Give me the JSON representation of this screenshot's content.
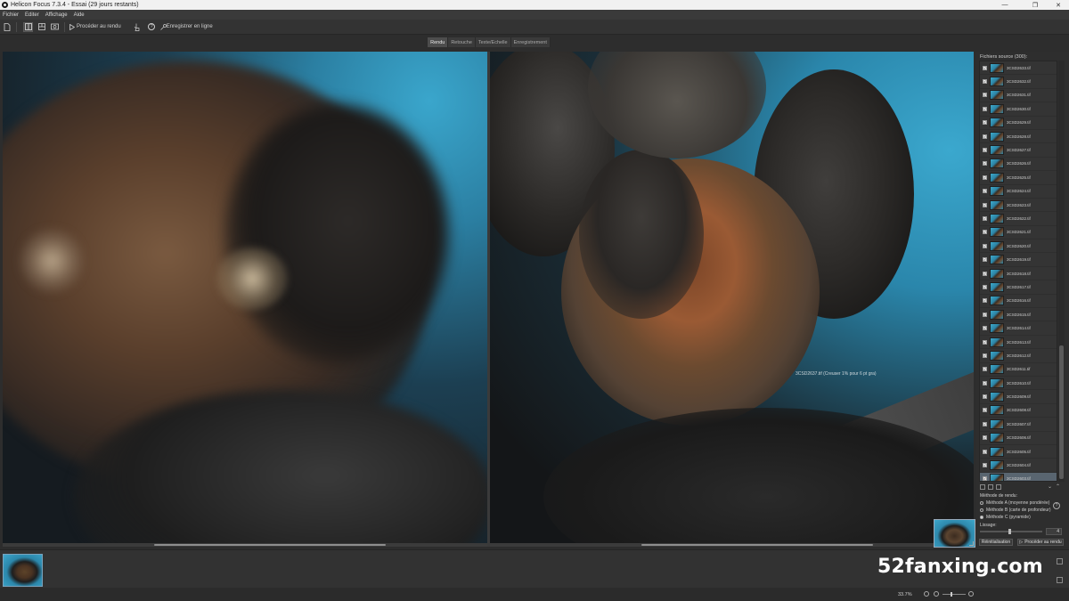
{
  "window": {
    "title": "Helicon Focus 7.3.4 - Essai (29 jours restants)",
    "minimize_glyph": "—",
    "maximize_glyph": "❐",
    "close_glyph": "✕"
  },
  "menu": [
    "Fichier",
    "Editer",
    "Affichage",
    "Aide"
  ],
  "toolbar": {
    "render_label": "Procéder au rendu",
    "save_online_label": "Enregistrer en ligne",
    "help_glyph": "?"
  },
  "tabs": [
    "Rendu",
    "Retouche",
    "Texte/Echelle",
    "Enregistrement"
  ],
  "active_tab": "Rendu",
  "viewer": {
    "tooltip": "3CSD2637.tif (Creuser 1% pour 6 pt gra)"
  },
  "source_panel": {
    "title": "Fichiers source (300):",
    "files": [
      "3CSD2633.tif",
      "3CSD2632.tif",
      "3CSD2631.tif",
      "3CSD2630.tif",
      "3CSD2629.tif",
      "3CSD2628.tif",
      "3CSD2627.tif",
      "3CSD2626.tif",
      "3CSD2625.tif",
      "3CSD2624.tif",
      "3CSD2623.tif",
      "3CSD2622.tif",
      "3CSD2621.tif",
      "3CSD2620.tif",
      "3CSD2619.tif",
      "3CSD2618.tif",
      "3CSD2617.tif",
      "3CSD2616.tif",
      "3CSD2615.tif",
      "3CSD2614.tif",
      "3CSD2613.tif",
      "3CSD2612.tif",
      "3CSD2611.tif",
      "3CSD2610.tif",
      "3CSD2609.tif",
      "3CSD2608.tif",
      "3CSD2607.tif",
      "3CSD2606.tif",
      "3CSD2605.tif",
      "3CSD2604.tif",
      "3CSD2603.tif"
    ],
    "selected_index": 30,
    "checkmark": "✓"
  },
  "render_method": {
    "title": "Méthode de rendu:",
    "options": [
      "Méthode A (moyenne pondérée)",
      "Méthode B (carte de profondeur)",
      "Méthode C (pyramide)"
    ],
    "selected_index": 2
  },
  "smoothing": {
    "label": "Lissage:",
    "value": "4"
  },
  "buttons": {
    "reset": "Réinitialisation",
    "render": "Procéder au rendu"
  },
  "watermark": "52fanxing.com",
  "status": {
    "zoom": "33.7%"
  }
}
